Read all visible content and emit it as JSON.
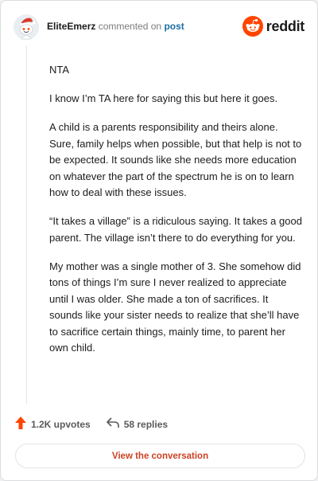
{
  "header": {
    "username": "EliteEmerz",
    "commented_text": "commented on",
    "post_link": "post",
    "brand": "reddit",
    "brand_color": "#ff4500",
    "avatar_icon": "snoo-avatar-icon",
    "brand_icon": "reddit-snoo-icon"
  },
  "comment": {
    "paragraphs": [
      "NTA",
      "I know I’m TA here for saying this but here it goes.",
      "A child is a parents responsibility and theirs alone. Sure, family helps when possible, but that help is not to be expected. It sounds like she needs more education on whatever the part of the spectrum he is on to learn how to deal with these issues.",
      "“It takes a village” is a ridiculous saying. It takes a good parent. The village isn’t there to do everything for you.",
      "My mother was a single mother of 3. She somehow did tons of things I’m sure I never realized to appreciate until I was older. She made a ton of sacrifices. It sounds like your sister needs to realize that she’ll have to sacrifice certain things, mainly time, to parent her own child."
    ]
  },
  "stats": {
    "upvotes": "1.2K upvotes",
    "replies": "58 replies",
    "upvote_icon": "upvote-arrow-icon",
    "reply_icon": "reply-arrow-icon",
    "upvote_color": "#ff4500"
  },
  "actions": {
    "view_conversation": "View the conversation",
    "button_text_color": "#cc4224"
  }
}
